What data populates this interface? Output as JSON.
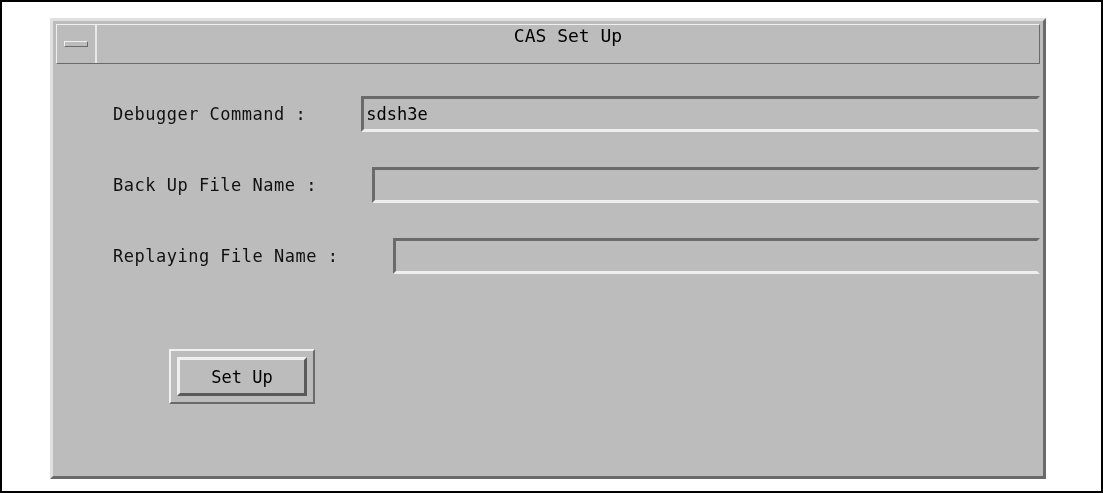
{
  "window": {
    "title": "CAS Set Up"
  },
  "fields": [
    {
      "label": "Debugger Command :",
      "value": "sdsh3e"
    },
    {
      "label": "Back Up File Name :"
    },
    {
      "label": "Replaying File Name :"
    }
  ],
  "buttons": [
    {
      "label": "Set Up",
      "default": true
    }
  ]
}
